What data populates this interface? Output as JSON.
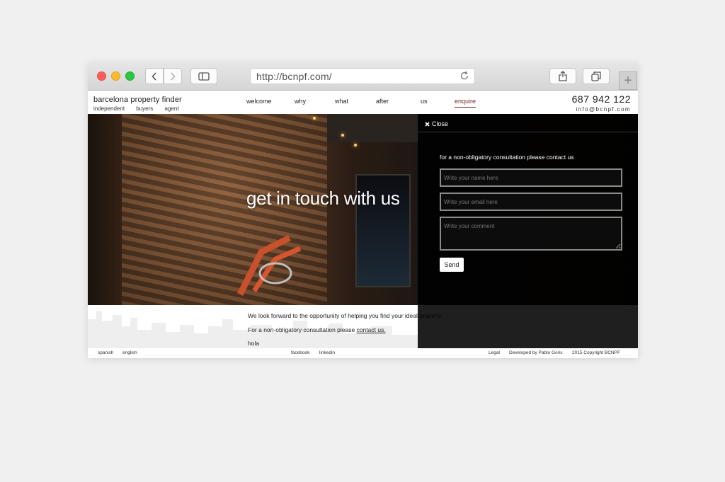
{
  "browser": {
    "url": "http://bcnpf.com/"
  },
  "site": {
    "logo": "barcelona property finder",
    "tagline": [
      "independent",
      "buyers",
      "agent"
    ],
    "nav": [
      "welcome",
      "why",
      "what",
      "after",
      "us",
      "enquire"
    ],
    "active_nav": "enquire",
    "phone": "687 942 122",
    "email": "info@bcnpf.com"
  },
  "hero": {
    "title": "get in touch with us"
  },
  "contact_panel": {
    "close_label": "Close",
    "intro": "for a non-obligatory consultation please contact us",
    "name_placeholder": "Write your name here",
    "email_placeholder": "Write your email here",
    "comment_placeholder": "Write your comment",
    "send_label": "Send"
  },
  "content": {
    "para1": "We look forward to the opportunity of helping you find your ideal property.",
    "para2_prefix": "For a non-obligatory consultation please",
    "para2_link": "contact us.",
    "para3": "hola"
  },
  "footer": {
    "lang_spanish": "spanish",
    "lang_english": "english",
    "facebook": "facebook",
    "linkedin": "linkedin",
    "legal": "Legal",
    "developed": "Developed by Pablo Goris",
    "copyright": "2015 Copyright BCNPF"
  },
  "colors": {
    "accent": "#7a2a2a",
    "panel_bg": "#000000",
    "background": "#f0f0f0"
  }
}
